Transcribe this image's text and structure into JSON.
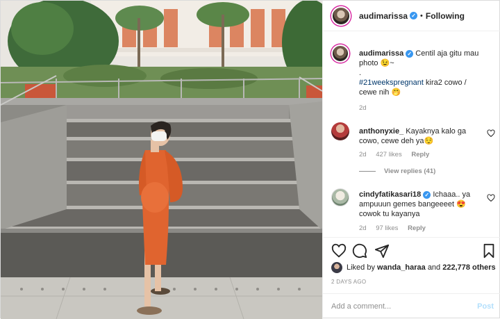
{
  "header": {
    "username": "audimarissa",
    "separator": "•",
    "follow_state": "Following"
  },
  "caption": {
    "username": "audimarissa",
    "text_line1": "Centil aja gitu mau photo 😉~",
    "text_line2": ".",
    "hashtag": "#21weekspregnant",
    "text_line3": " kira2 cowo / cewe nih 🤭",
    "time": "2d"
  },
  "comments": [
    {
      "username": "anthonyxie_",
      "text": "Kayaknya kalo ga cowo, cewe deh ya😌",
      "time": "2d",
      "likes": "427 likes",
      "reply": "Reply",
      "view_replies": "View replies (41)"
    },
    {
      "username": "cindyfatikasari18",
      "text": "Ichaaa.. ya ampuuun gemes bangeeeet 😍 cowok tu kayanya",
      "time": "2d",
      "likes": "97 likes",
      "reply": "Reply"
    }
  ],
  "actions": {
    "icons": [
      "heart-icon",
      "comment-icon",
      "share-icon",
      "bookmark-icon"
    ]
  },
  "likes": {
    "prefix": "Liked by",
    "user": "wanda_haraa",
    "middle": "and",
    "count": "222,778 others"
  },
  "posted": "2 DAYS AGO",
  "add_comment": {
    "placeholder": "Add a comment...",
    "post_label": "Post"
  },
  "colors": {
    "verified": "#3897f0",
    "hashtag": "#00376b",
    "post_disabled": "#b2dffc",
    "dress": "#e0642f"
  }
}
